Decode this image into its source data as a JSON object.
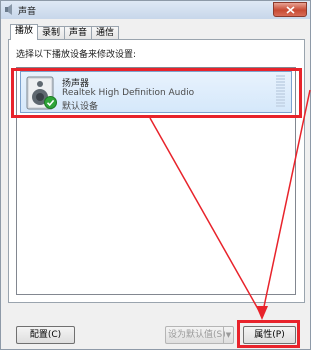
{
  "window": {
    "title": "声音",
    "close_icon": "close-icon"
  },
  "tabs": [
    {
      "label": "播放",
      "active": true
    },
    {
      "label": "录制",
      "active": false
    },
    {
      "label": "声音",
      "active": false
    },
    {
      "label": "通信",
      "active": false
    }
  ],
  "instruction": "选择以下播放设备来修改设置:",
  "device": {
    "name": "扬声器",
    "description": "Realtek High Definition Audio",
    "status": "默认设备",
    "icon": "speaker-icon",
    "badge_icon": "check-icon"
  },
  "buttons": {
    "configure": "配置(C)",
    "set_default": "设为默认值(S)",
    "properties": "属性(P)"
  },
  "colors": {
    "highlight": "#e8232b",
    "selection": "#d5e8fb"
  }
}
